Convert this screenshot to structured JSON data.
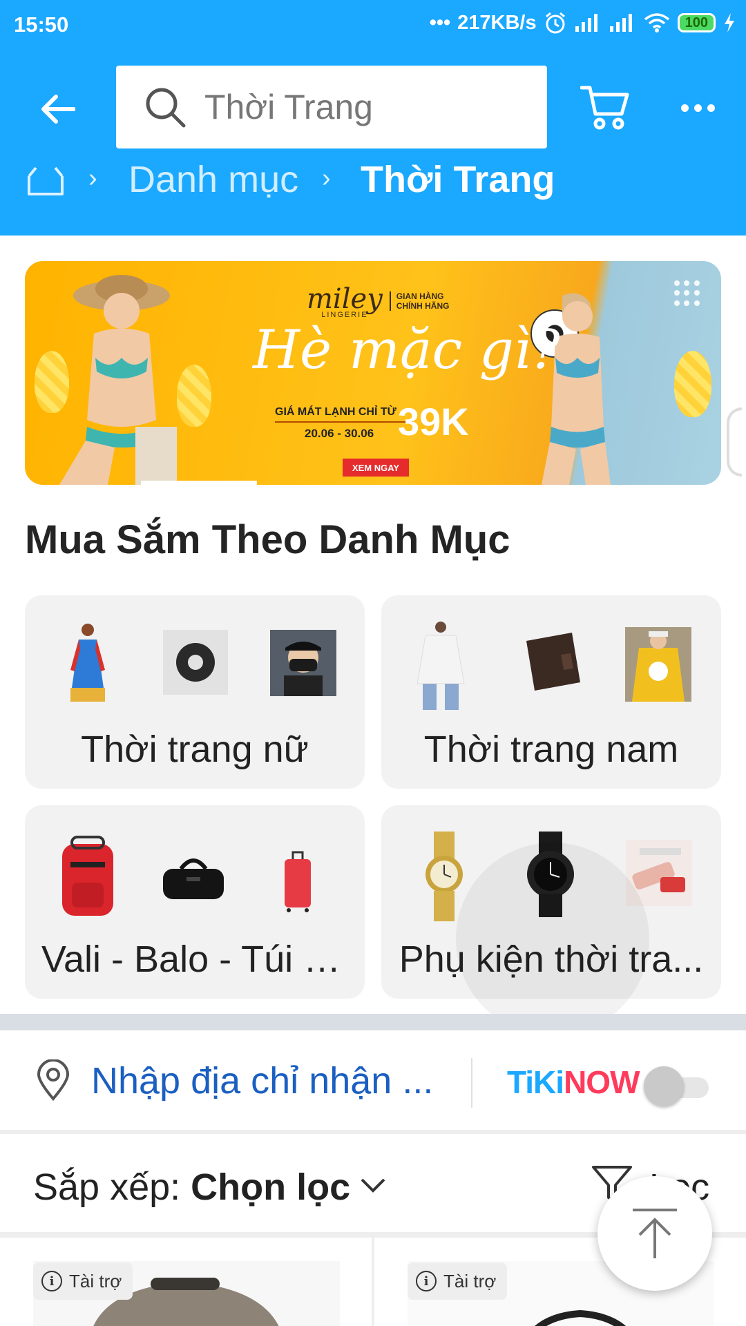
{
  "status_bar": {
    "time": "15:50",
    "network_speed": "217KB/s",
    "battery": "100"
  },
  "header": {
    "search_text": "Thời Trang",
    "icons": [
      "back-arrow-icon",
      "search-icon",
      "cart-icon",
      "more-icon"
    ],
    "color": "#1ba8ff"
  },
  "breadcrumb": {
    "items": [
      "Danh mục",
      "Thời Trang"
    ]
  },
  "banner": {
    "brand": "miley",
    "brand_sub": "LINGERIE",
    "brand_tag_line1": "GIAN HÀNG",
    "brand_tag_line2": "CHÍNH HÃNG",
    "headline": "Hè mặc gì?",
    "price_label": "GIÁ MÁT LẠNH CHỈ TỪ",
    "price_dates": "20.06 - 30.06",
    "price_value": "39K",
    "cta": "XEM NGAY"
  },
  "categories": {
    "title": "Mua Sắm Theo Danh Mục",
    "items": [
      {
        "label": "Thời trang nữ"
      },
      {
        "label": "Thời trang nam"
      },
      {
        "label": "Vali - Balo - Túi x..."
      },
      {
        "label": "Phụ kiện thời tra..."
      }
    ]
  },
  "address": {
    "placeholder": "Nhập địa chỉ nhận ...",
    "tikinow_part1": "TiKi",
    "tikinow_part2": "NOW",
    "tikinow_on": false
  },
  "sort": {
    "label": "Sắp xếp: ",
    "value": "Chọn lọc",
    "filter_label": "Lọc"
  },
  "products": [
    {
      "badge": "Tài trợ"
    },
    {
      "badge": "Tài trợ"
    }
  ],
  "colors": {
    "accent": "#1ba8ff",
    "link": "#1a5fc1",
    "tiki_pink": "#ff3b5c"
  }
}
